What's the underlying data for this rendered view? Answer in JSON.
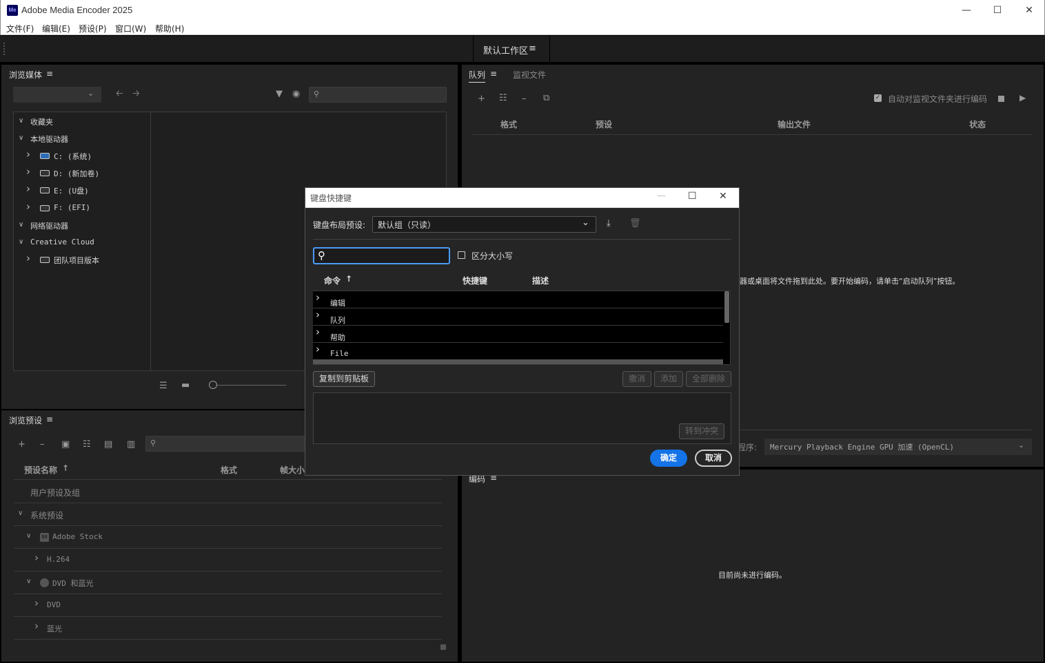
{
  "app": {
    "title": "Adobe Media Encoder 2025",
    "logo_text": "Me"
  },
  "menus": [
    "文件(F)",
    "编辑(E)",
    "预设(P)",
    "窗口(W)",
    "帮助(H)"
  ],
  "workspace": {
    "label": "默认工作区"
  },
  "media_browser": {
    "title": "浏览媒体",
    "tree": [
      {
        "label": "收藏夹",
        "level": 0,
        "expanded": true
      },
      {
        "label": "本地驱动器",
        "level": 0,
        "expanded": true
      },
      {
        "label": "C: (系统)",
        "level": 1,
        "expanded": false,
        "icon": "system-drive-icon"
      },
      {
        "label": "D: (新加卷)",
        "level": 1,
        "expanded": false,
        "icon": "drive-icon"
      },
      {
        "label": "E: (U盘)",
        "level": 1,
        "expanded": false,
        "icon": "drive-icon"
      },
      {
        "label": "F: (EFI)",
        "level": 1,
        "expanded": false,
        "icon": "drive-icon"
      },
      {
        "label": "网络驱动器",
        "level": 0,
        "expanded": true
      },
      {
        "label": "Creative Cloud",
        "level": 0,
        "expanded": true
      },
      {
        "label": "团队项目版本",
        "level": 1,
        "expanded": false,
        "icon": "team-project-icon"
      }
    ]
  },
  "preset_browser": {
    "title": "浏览预设",
    "columns": {
      "name": "预设名称",
      "format": "格式",
      "frame_size": "帧大小"
    },
    "rows": [
      {
        "label": "用户预设及组",
        "level": 0,
        "chevron": ""
      },
      {
        "label": "系统预设",
        "level": 0,
        "chevron": "down"
      },
      {
        "label": "Adobe Stock",
        "level": 1,
        "chevron": "down",
        "badge": "St"
      },
      {
        "label": "H.264",
        "level": 2,
        "chevron": "right"
      },
      {
        "label": "DVD 和蓝光",
        "level": 1,
        "chevron": "down",
        "badge": "disc"
      },
      {
        "label": "DVD",
        "level": 2,
        "chevron": "right"
      },
      {
        "label": "蓝光",
        "level": 2,
        "chevron": "right"
      }
    ]
  },
  "queue": {
    "tab_queue": "队列",
    "tab_watch": "监视文件",
    "auto_encode_label": "自动对监视文件夹进行编码",
    "auto_encode_checked": true,
    "columns": {
      "format": "格式",
      "preset": "预设",
      "output": "输出文件",
      "status": "状态"
    },
    "empty_hint": "器或桌面将文件拖到此处。要开始编码，请单击“启动队列”按钮。",
    "renderer_label": "程序:",
    "renderer_value": "Mercury Playback Engine GPU 加速 (OpenCL)"
  },
  "encoding": {
    "title": "编码",
    "empty": "目前尚未进行编码。"
  },
  "dialog": {
    "title": "键盘快捷键",
    "layout_label": "键盘布局预设:",
    "layout_value": "默认组（只读）",
    "search_placeholder": "",
    "case_label": "区分大小写",
    "case_checked": false,
    "columns": {
      "command": "命令",
      "shortcut": "快捷键",
      "description": "描述"
    },
    "commands": [
      "编辑",
      "队列",
      "帮助",
      "File"
    ],
    "copy_button": "复制到剪贴板",
    "undo_button": "撤消",
    "add_button": "添加",
    "clear_all_button": "全部删除",
    "goto_conflict_button": "转到冲突",
    "ok_button": "确定",
    "cancel_button": "取消"
  },
  "colors": {
    "accent": "#1473e6",
    "panel_bg": "#232323",
    "workspace_bg": "#1d1d1d"
  }
}
